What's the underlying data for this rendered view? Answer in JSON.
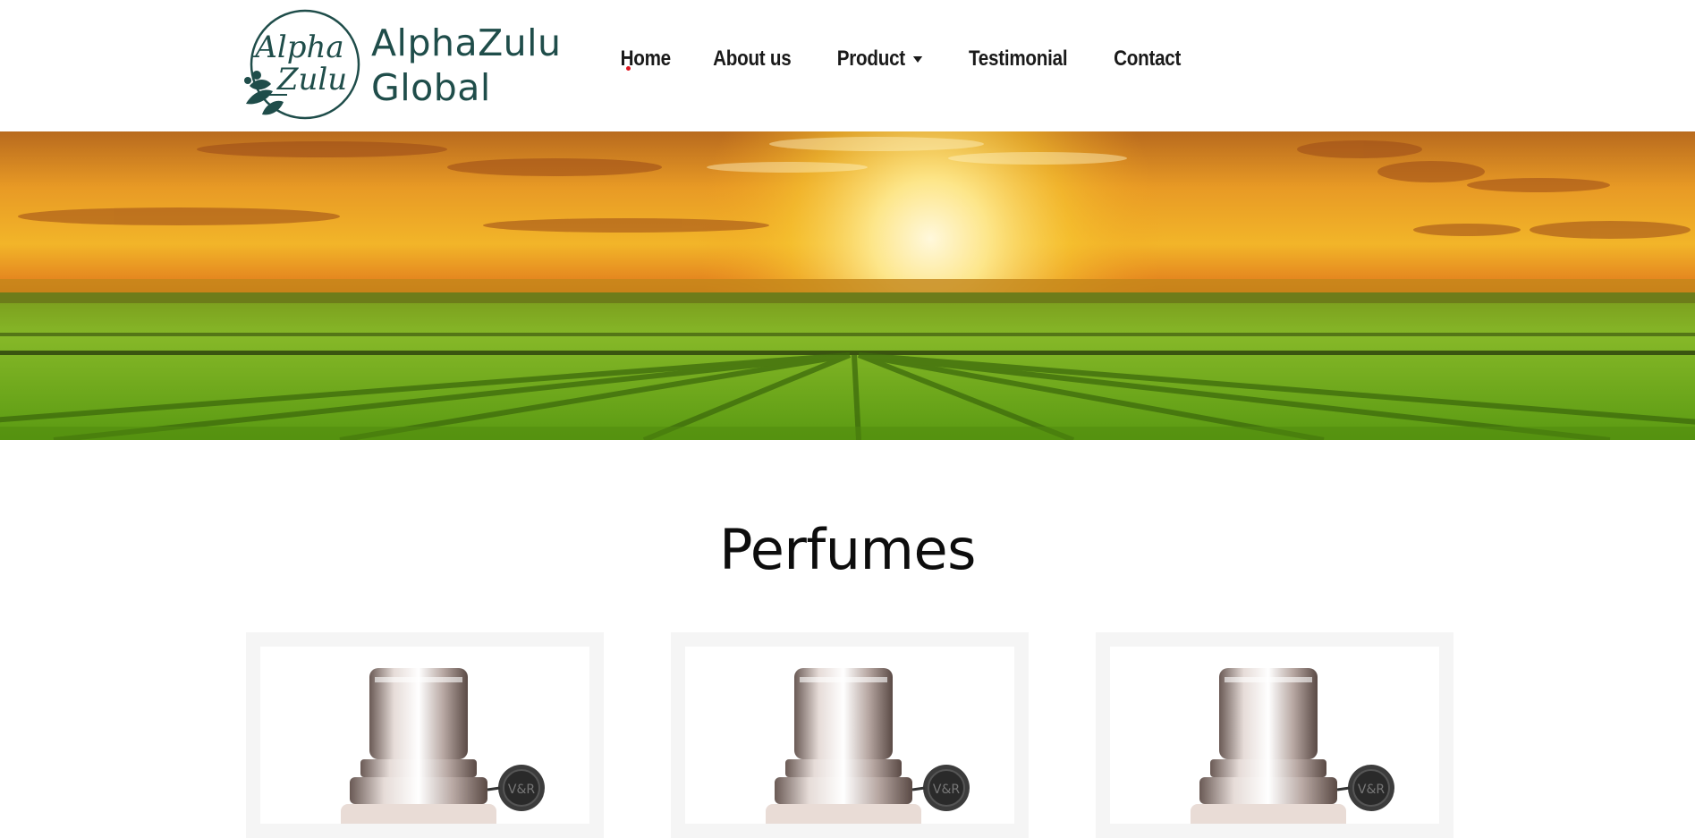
{
  "brand": {
    "name_line1": "AlphaZulu",
    "name_line2": "Global",
    "emblem_script_line1": "Alpha",
    "emblem_script_line2": "Zulu",
    "color": "#1f4d4a"
  },
  "nav": {
    "items": [
      {
        "label": "Home",
        "has_dropdown": false
      },
      {
        "label": "About us",
        "has_dropdown": false
      },
      {
        "label": "Product",
        "has_dropdown": true
      },
      {
        "label": "Testimonial",
        "has_dropdown": false
      },
      {
        "label": "Contact",
        "has_dropdown": false
      }
    ]
  },
  "hero": {
    "image": "sunset-over-green-crop-field"
  },
  "section": {
    "title": "Perfumes"
  },
  "products": [
    {
      "image": "perfume-bottle",
      "cap_text": "V&R"
    },
    {
      "image": "perfume-bottle",
      "cap_text": "V&R"
    },
    {
      "image": "perfume-bottle",
      "cap_text": "V&R"
    }
  ],
  "colors": {
    "accent_dot": "#e0141f",
    "text": "#1a1a1a",
    "card_bg": "#f5f5f5"
  }
}
